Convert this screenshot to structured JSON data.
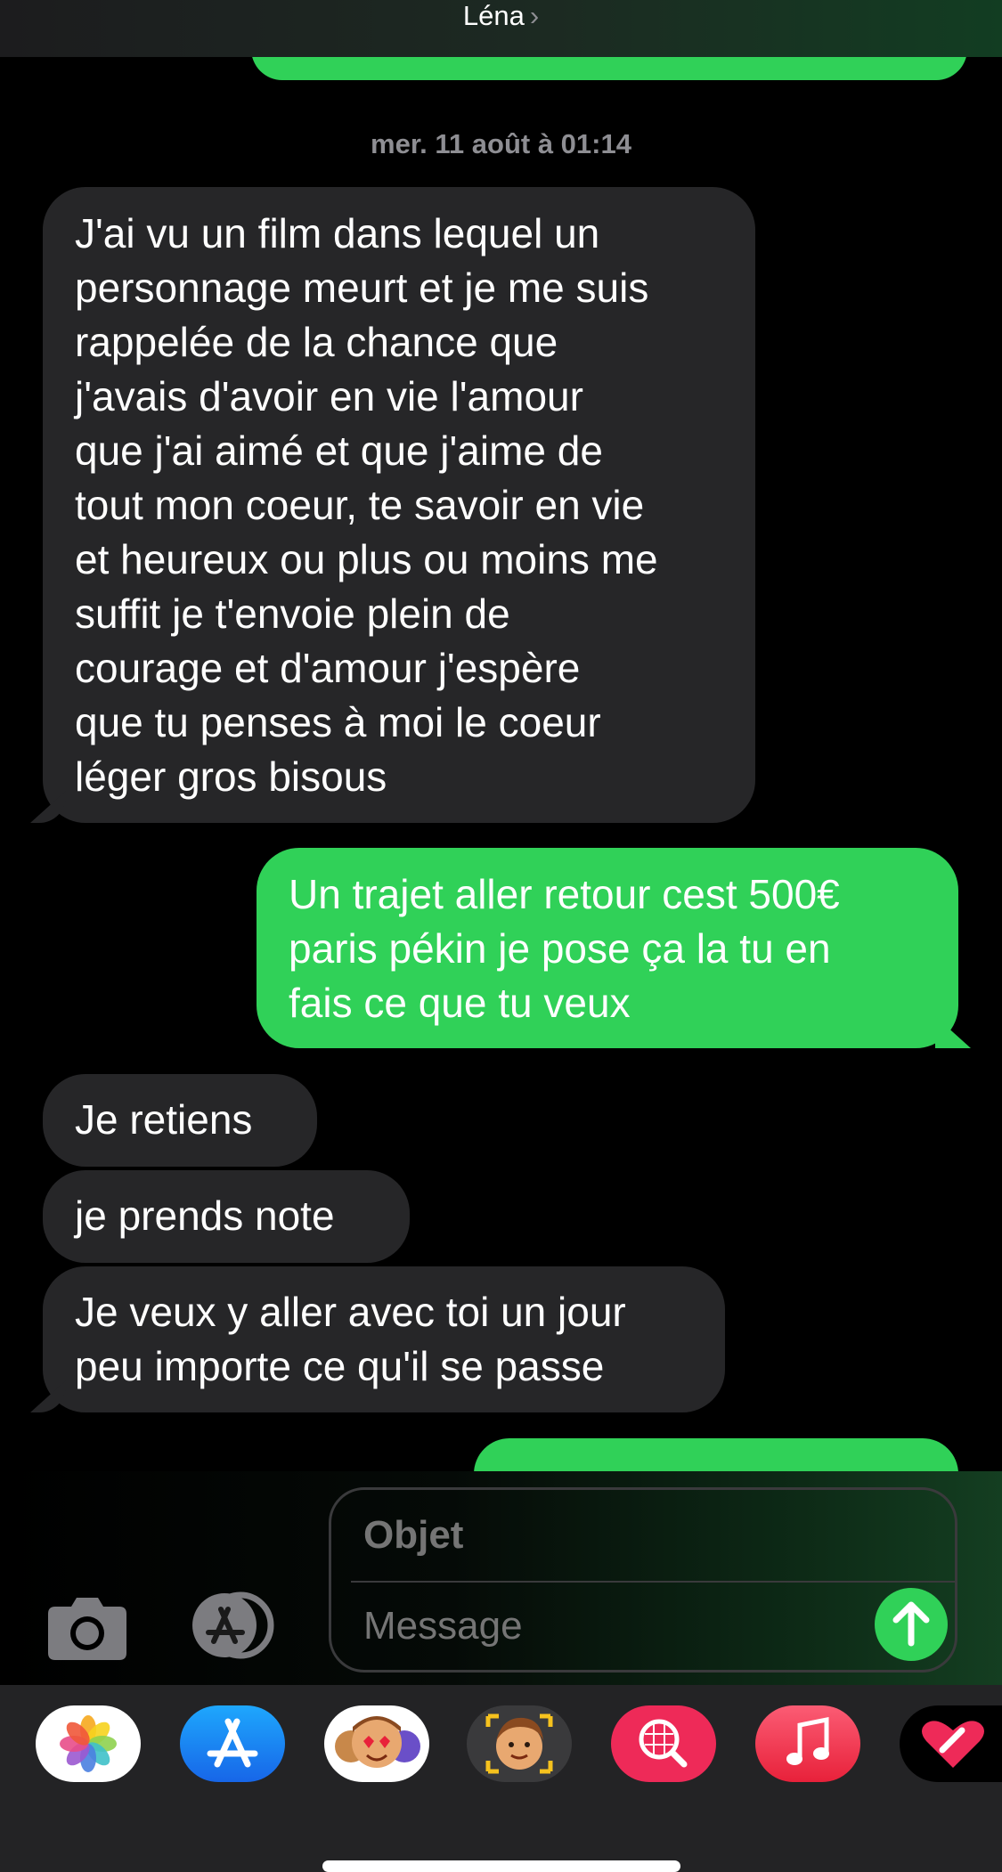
{
  "header": {
    "contact_name": "Léna",
    "chevron": "›"
  },
  "conversation": {
    "timestamp": "mer. 11 août à 01:14",
    "messages": [
      {
        "direction": "received",
        "lines": [
          "J'ai vu un film dans lequel un",
          "personnage meurt et je me suis",
          "rappelée de la chance que",
          "j'avais d'avoir en vie l'amour",
          "que j'ai aimé et que j'aime de",
          "tout mon coeur, te savoir en vie",
          "et heureux ou plus ou moins me",
          "suffit je t'envoie plein de",
          "courage et d'amour j'espère",
          "que tu penses à moi le coeur",
          "léger gros bisous"
        ]
      },
      {
        "direction": "sent",
        "lines": [
          "Un trajet aller retour cest 500€",
          "paris pékin je pose ça la tu en",
          "fais ce que tu veux"
        ]
      },
      {
        "direction": "received",
        "lines": [
          "Je retiens"
        ]
      },
      {
        "direction": "received",
        "lines": [
          "je prends note"
        ]
      },
      {
        "direction": "received",
        "lines": [
          "Je veux y aller avec toi un jour",
          "peu importe ce qu'il se passe"
        ]
      }
    ]
  },
  "compose": {
    "subject_placeholder": "Objet",
    "message_placeholder": "Message"
  },
  "icons": {
    "camera": "camera-icon",
    "app_store": "app-store-icon",
    "send": "arrow-up-icon"
  },
  "app_drawer": [
    {
      "name": "photos-app-icon"
    },
    {
      "name": "app-store-app-icon"
    },
    {
      "name": "memoji-stickers-app-icon"
    },
    {
      "name": "memoji-app-icon"
    },
    {
      "name": "gif-search-app-icon"
    },
    {
      "name": "music-app-icon"
    },
    {
      "name": "digital-touch-app-icon"
    }
  ],
  "colors": {
    "sent_bubble": "#30d158",
    "received_bubble": "#262628",
    "background": "#000000",
    "timestamp": "#8e8e93"
  }
}
